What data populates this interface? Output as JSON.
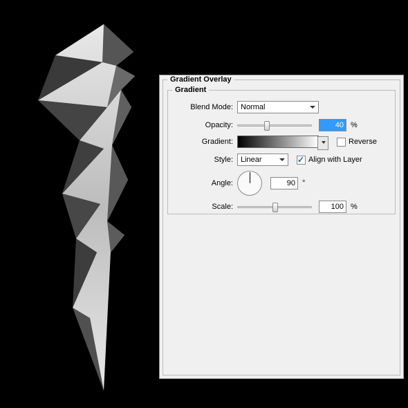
{
  "panel": {
    "title": "Gradient Overlay",
    "section": "Gradient"
  },
  "labels": {
    "blendMode": "Blend Mode:",
    "opacity": "Opacity:",
    "gradient": "Gradient:",
    "style": "Style:",
    "angle": "Angle:",
    "scale": "Scale:",
    "reverse": "Reverse",
    "alignWithLayer": "Align with Layer"
  },
  "values": {
    "blendMode": "Normal",
    "opacity": "40",
    "style": "Linear",
    "angle": "90",
    "scale": "100",
    "reverseChecked": false,
    "alignChecked": true
  },
  "units": {
    "percent": "%",
    "degree": "°"
  },
  "chart_data": {
    "type": "table",
    "title": "Gradient Overlay settings",
    "rows": [
      {
        "property": "Blend Mode",
        "value": "Normal"
      },
      {
        "property": "Opacity",
        "value": 40,
        "unit": "%"
      },
      {
        "property": "Gradient",
        "value": "Black → White"
      },
      {
        "property": "Reverse",
        "value": false
      },
      {
        "property": "Style",
        "value": "Linear"
      },
      {
        "property": "Align with Layer",
        "value": true
      },
      {
        "property": "Angle",
        "value": 90,
        "unit": "°"
      },
      {
        "property": "Scale",
        "value": 100,
        "unit": "%"
      }
    ]
  }
}
